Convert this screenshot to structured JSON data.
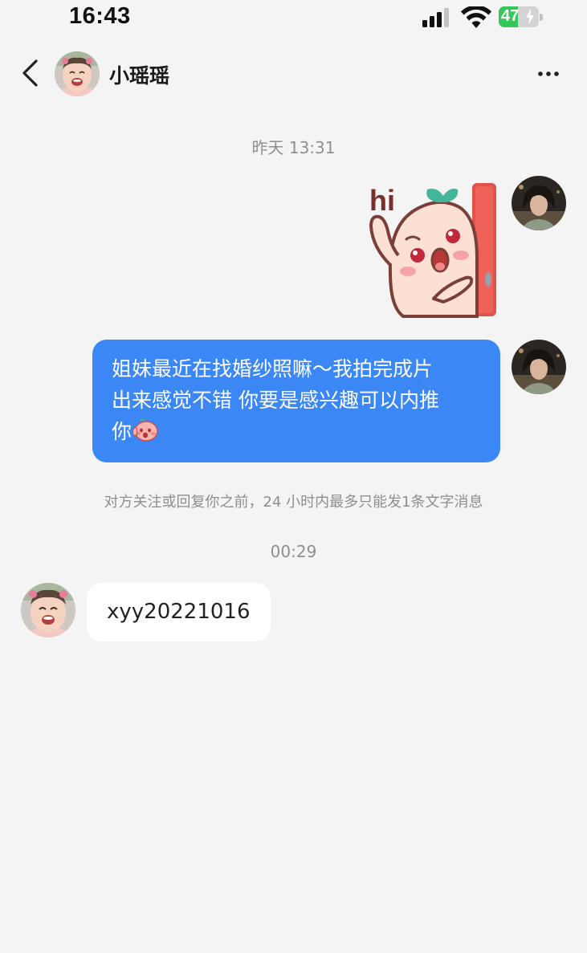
{
  "status_bar": {
    "time": "16:43",
    "battery_level": "47",
    "battery_fraction": 0.47,
    "battery_charging": true,
    "icons": [
      "cellular-signal-icon",
      "wifi-icon",
      "battery-icon"
    ]
  },
  "header": {
    "back_icon": "chevron-left-icon",
    "contact_name": "小瑶瑶",
    "more_icon": "more-dots-icon"
  },
  "messages": [
    {
      "type": "timestamp",
      "text": "昨天 13:31"
    },
    {
      "type": "sticker",
      "direction": "outgoing",
      "sticker_text": "hi"
    },
    {
      "type": "text",
      "direction": "outgoing",
      "lines": [
        "姐妹最近在找婚纱照嘛～我拍完成片",
        "出来感觉不错  你要是感兴趣可以内推",
        "你"
      ],
      "trailing_emoji": "blushing-peach-emoji"
    },
    {
      "type": "system",
      "text": "对方关注或回复你之前，24 小时内最多只能发1条文字消息"
    },
    {
      "type": "timestamp",
      "text": "00:29"
    },
    {
      "type": "text",
      "direction": "incoming",
      "text": "xyy20221016"
    }
  ],
  "colors": {
    "background": "#f4f4f5",
    "outgoing_bubble": "#3b87f5",
    "incoming_bubble": "#ffffff",
    "meta_text": "#8e8e93",
    "battery_green": "#34c759"
  }
}
